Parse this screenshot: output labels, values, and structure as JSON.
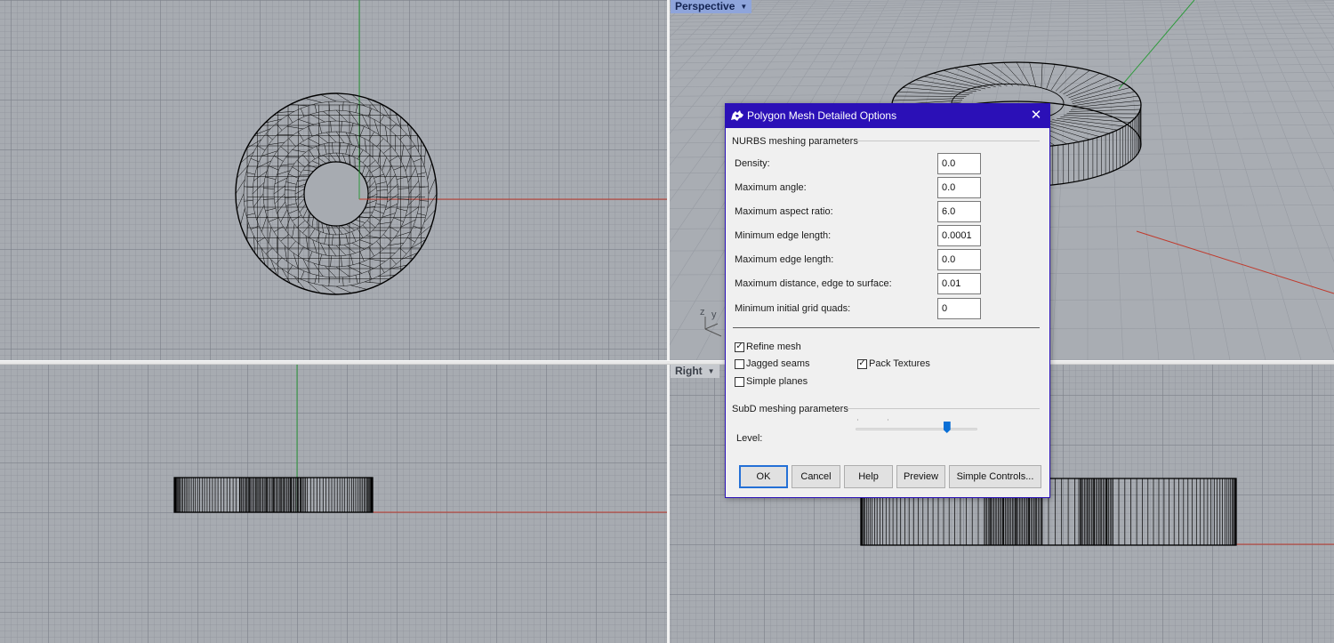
{
  "viewports": {
    "perspective": {
      "label": "Perspective"
    },
    "right": {
      "label": "Right"
    },
    "axis_labels": {
      "z": "z",
      "y": "y"
    }
  },
  "dialog": {
    "title": "Polygon Mesh Detailed Options",
    "close_glyph": "✕",
    "nurbs_section": "NURBS meshing parameters",
    "fields": [
      {
        "label": "Density:",
        "value": "0.0"
      },
      {
        "label": "Maximum angle:",
        "value": "0.0"
      },
      {
        "label": "Maximum aspect ratio:",
        "value": "6.0"
      },
      {
        "label": "Minimum edge length:",
        "value": "0.0001"
      },
      {
        "label": "Maximum edge length:",
        "value": "0.0"
      },
      {
        "label": "Maximum distance, edge to surface:",
        "value": "0.01"
      },
      {
        "label": "Minimum initial grid quads:",
        "value": "0"
      }
    ],
    "checkboxes": {
      "refine_mesh": {
        "label": "Refine mesh",
        "checked": true
      },
      "jagged_seams": {
        "label": "Jagged seams",
        "checked": false
      },
      "pack_textures": {
        "label": "Pack Textures",
        "checked": true
      },
      "simple_planes": {
        "label": "Simple planes",
        "checked": false
      }
    },
    "subd_section": "SubD meshing parameters",
    "level_label": "Level:",
    "level_fraction": 0.75,
    "buttons": {
      "ok": "OK",
      "cancel": "Cancel",
      "help": "Help",
      "preview": "Preview",
      "simple_controls": "Simple Controls..."
    }
  },
  "colors": {
    "titlebar": "#2b10b7",
    "x_axis": "#c0392b",
    "y_axis": "#2e9a3c",
    "wireframe": "#000000",
    "perspective_tab": "#8fa5db"
  },
  "icons": {
    "app_logo": "rhino-logo-icon",
    "close": "close-icon",
    "dropdown": "caret-down-icon",
    "check": "check-icon"
  }
}
